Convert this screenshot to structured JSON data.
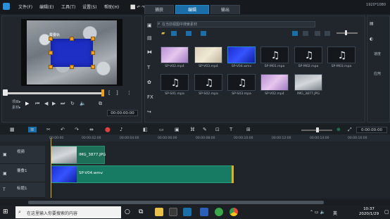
{
  "titlebar": {
    "menus": [
      "文件(F)",
      "编辑(E)",
      "工具(T)",
      "设置(S)",
      "帮助(H)"
    ],
    "tabs": [
      "捕获",
      "编辑",
      "输出"
    ],
    "active_tab": "编辑",
    "resolution": "1920*1080"
  },
  "player": {
    "overlay_label": "覆叠轨",
    "project_label": "项目▸",
    "clip_label": "素材▸",
    "timecode": "00:00:00:00"
  },
  "library": {
    "search_placeholder": "在当前视图中搜索素材",
    "items": [
      {
        "name": "SP-V02.mp4",
        "kind": "video-pink"
      },
      {
        "name": "SP-V03.mp4",
        "kind": "video-beige"
      },
      {
        "name": "SP-V04.wmv",
        "kind": "video-blue"
      },
      {
        "name": "SP-M01.mpa",
        "kind": "audio"
      },
      {
        "name": "SP-M02.mpa",
        "kind": "audio"
      },
      {
        "name": "SP-M03.mpa",
        "kind": "audio"
      },
      {
        "name": "SP-S01.mpa",
        "kind": "audio"
      },
      {
        "name": "SP-S02.mpa",
        "kind": "audio"
      },
      {
        "name": "SP-S03.mpa",
        "kind": "audio"
      },
      {
        "name": "SP-V02.mp4",
        "kind": "video-pink"
      },
      {
        "name": "IMG_3877.JPG",
        "kind": "photo"
      }
    ],
    "side_icons": [
      "folder-icon",
      "media-icon",
      "transition-icon",
      "title-icon",
      "graphic-icon",
      "fx-icon",
      "path-icon"
    ]
  },
  "right_panel": {
    "labels": [
      "速度",
      "应用"
    ]
  },
  "timeline": {
    "time": "0:00:00:00",
    "ruler": [
      "00:00:00",
      "00:00:02:00",
      "00:00:04:00",
      "00:00:06:00",
      "00:00:08:00",
      "00:00:10:00",
      "00:00:12:00",
      "00:00:14:00",
      "00:00:16:00",
      "00:00:18:00"
    ],
    "tracks": [
      {
        "name": "视频",
        "clip": "IMG_3877.JPG"
      },
      {
        "name": "覆叠1",
        "clip": "SP-V04.wmv"
      },
      {
        "name": "标题1",
        "clip": ""
      }
    ]
  },
  "taskbar": {
    "search_placeholder": "在这里输入你要搜索的内容",
    "ime": "英",
    "time": "10:37",
    "date": "2020/1/29"
  },
  "colors": {
    "accent": "#1b6fa8",
    "clip_green": "#177a62",
    "overlay_blue": "#1d2fc4",
    "handle_orange": "#f0a020"
  }
}
